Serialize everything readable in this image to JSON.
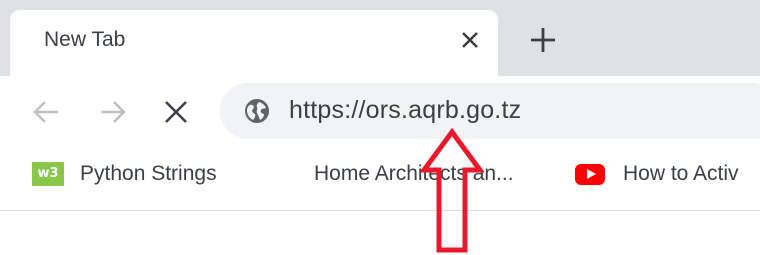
{
  "tab": {
    "title": "New Tab"
  },
  "icons": {
    "tab_close": "close-icon",
    "new_tab": "plus-icon",
    "back": "arrow-left-icon",
    "forward": "arrow-right-icon",
    "stop": "close-icon",
    "site_info": "globe-icon"
  },
  "address_bar": {
    "url": "https://ors.aqrb.go.tz"
  },
  "bookmarks": [
    {
      "label": "Python Strings",
      "icon": "w3schools-icon",
      "icon_text": "w3"
    },
    {
      "label": "Home Architects an...",
      "icon": ""
    },
    {
      "label": "How to Activ",
      "icon": "youtube-icon"
    }
  ],
  "colors": {
    "tabstrip": "#dee1e6",
    "omnibox": "#f1f3f4",
    "annotation_arrow": "#e8192c",
    "w3_green": "#8ac64a",
    "youtube_red": "#ff0000"
  }
}
